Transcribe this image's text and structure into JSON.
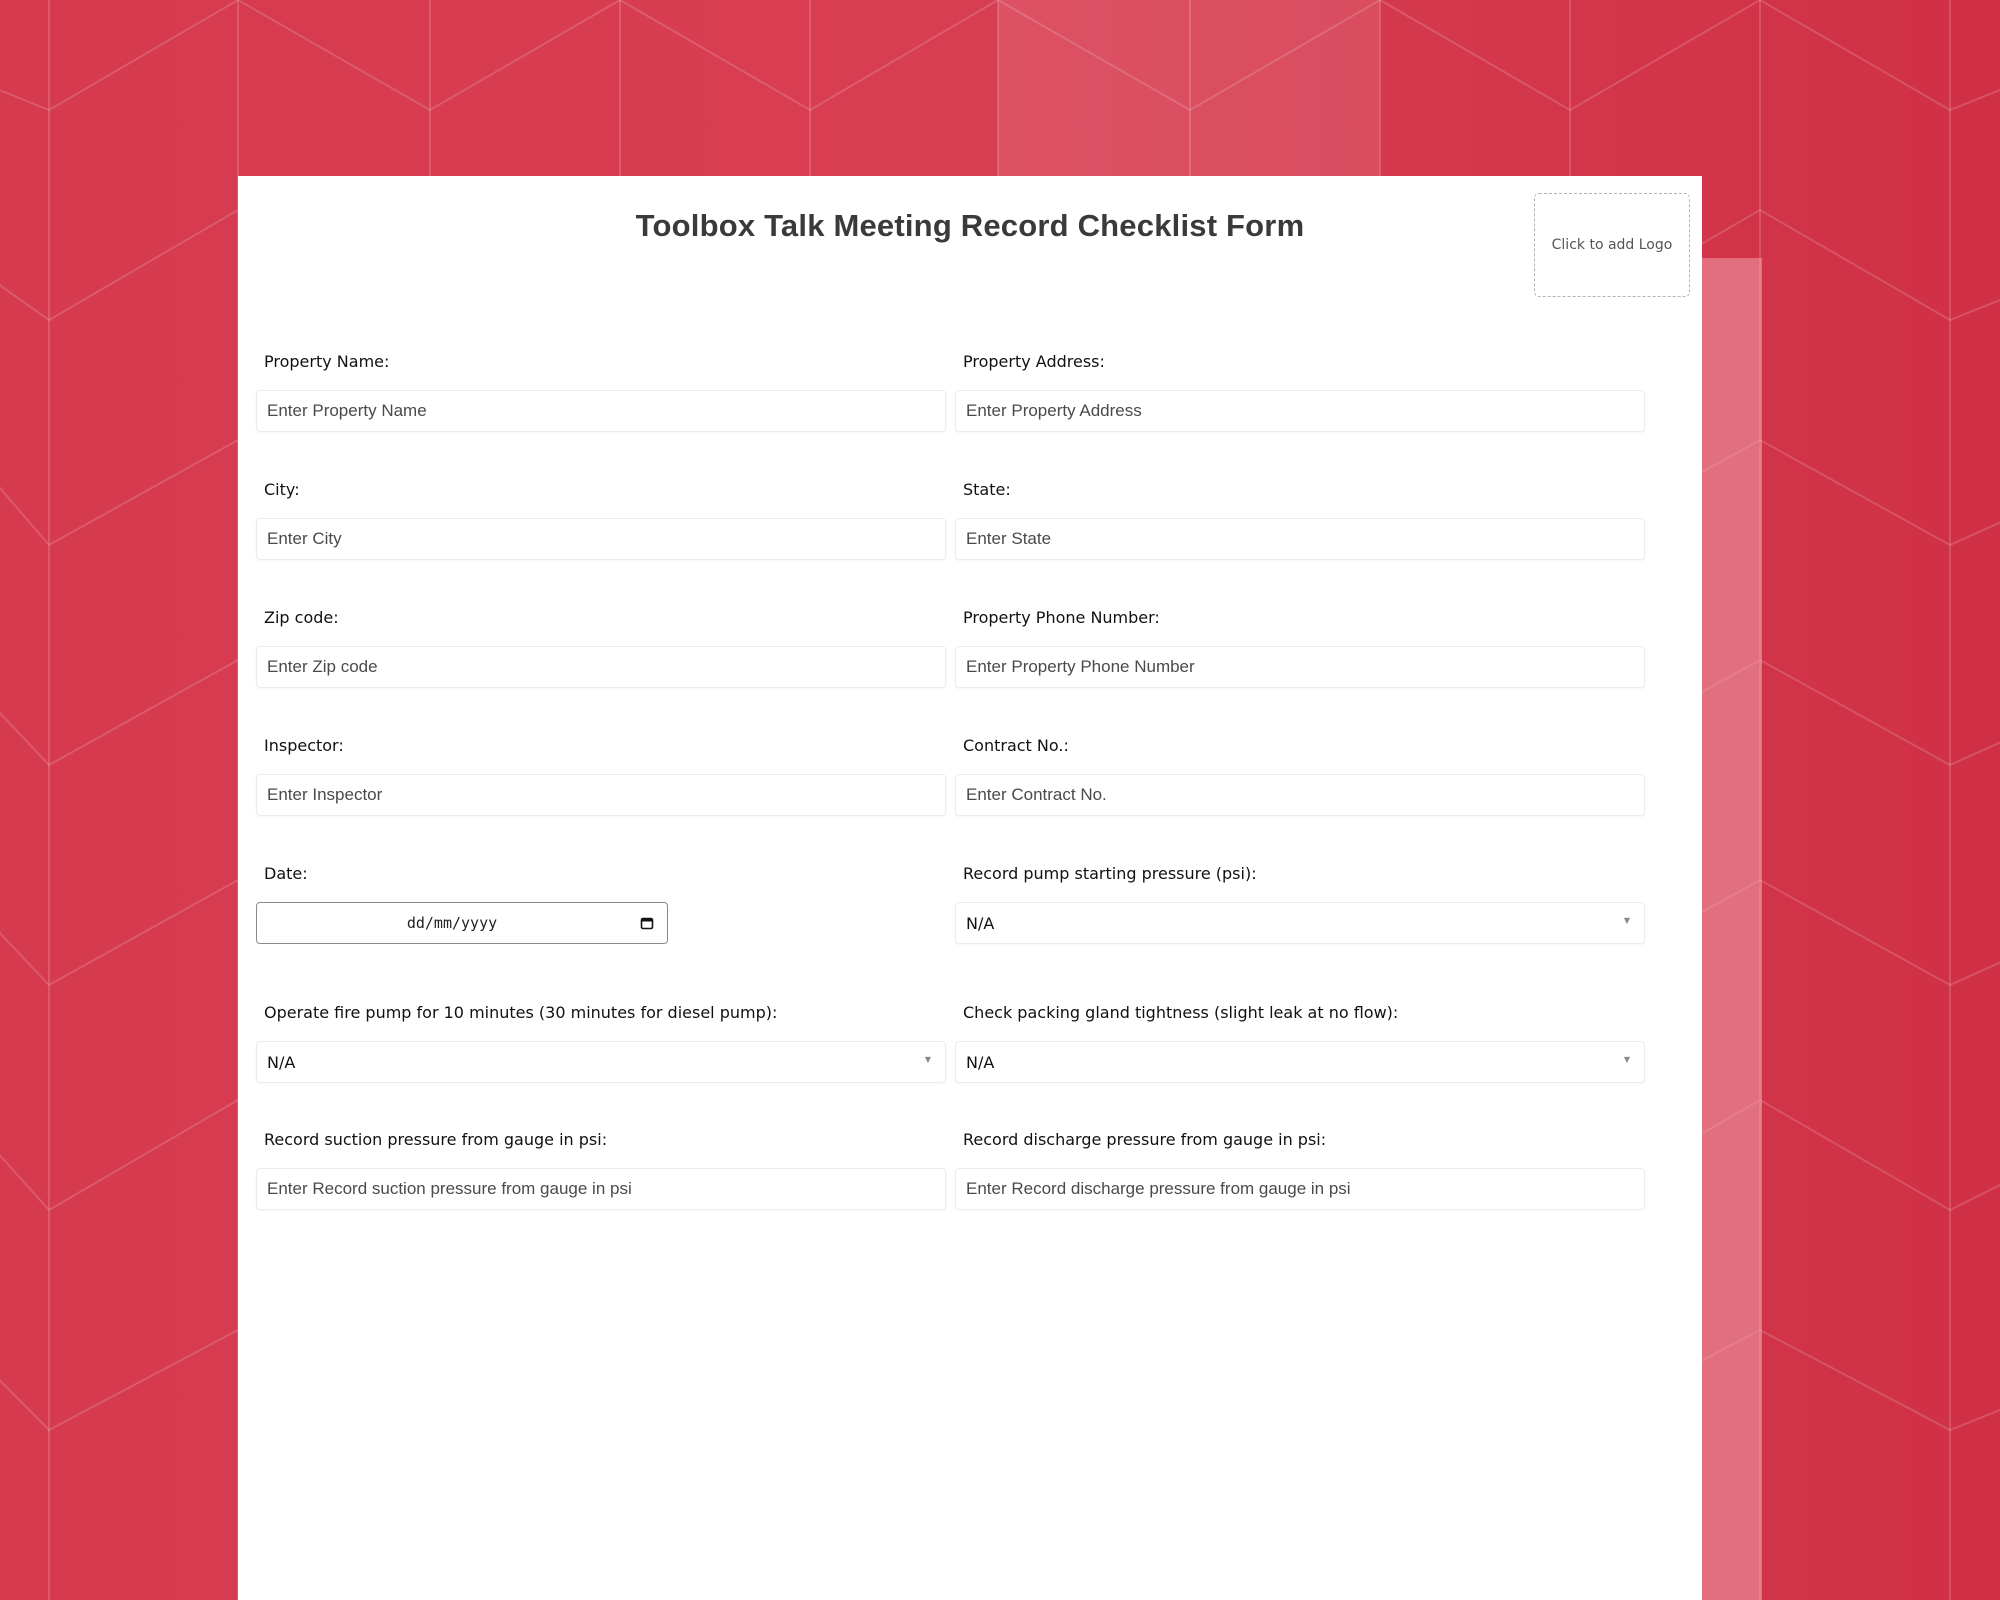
{
  "colors": {
    "background": "#d6394d",
    "paper": "#ffffff",
    "title": "#3a3a3a"
  },
  "form": {
    "title": "Toolbox Talk Meeting Record Checklist Form",
    "logo_placeholder": "Click to add Logo",
    "fields": [
      {
        "label": "Property Name:",
        "type": "text",
        "placeholder": "Enter Property Name"
      },
      {
        "label": "Property Address:",
        "type": "text",
        "placeholder": "Enter Property Address"
      },
      {
        "label": "City:",
        "type": "text",
        "placeholder": "Enter City"
      },
      {
        "label": "State:",
        "type": "text",
        "placeholder": "Enter State"
      },
      {
        "label": "Zip code:",
        "type": "text",
        "placeholder": "Enter Zip code"
      },
      {
        "label": "Property Phone Number:",
        "type": "text",
        "placeholder": "Enter Property Phone Number"
      },
      {
        "label": "Inspector:",
        "type": "text",
        "placeholder": "Enter Inspector"
      },
      {
        "label": "Contract No.:",
        "type": "text",
        "placeholder": "Enter Contract No."
      },
      {
        "label": "Date:",
        "type": "date",
        "placeholder": "dd/mm/yyyy",
        "icon": "calendar-icon"
      },
      {
        "label": "Record pump starting pressure (psi):",
        "type": "select",
        "value": "N/A",
        "icon": "chevron-down-icon"
      },
      {
        "label": "Operate fire pump for 10 minutes (30 minutes for diesel pump):",
        "type": "select",
        "value": "N/A",
        "icon": "chevron-down-icon"
      },
      {
        "label": "Check packing gland tightness (slight leak at no flow):",
        "type": "select",
        "value": "N/A",
        "icon": "chevron-down-icon"
      },
      {
        "label": "Record suction pressure from gauge in psi:",
        "type": "text",
        "placeholder": "Enter Record suction pressure from gauge in psi"
      },
      {
        "label": "Record discharge pressure from gauge in psi:",
        "type": "text",
        "placeholder": "Enter Record discharge pressure from gauge in psi"
      }
    ]
  }
}
